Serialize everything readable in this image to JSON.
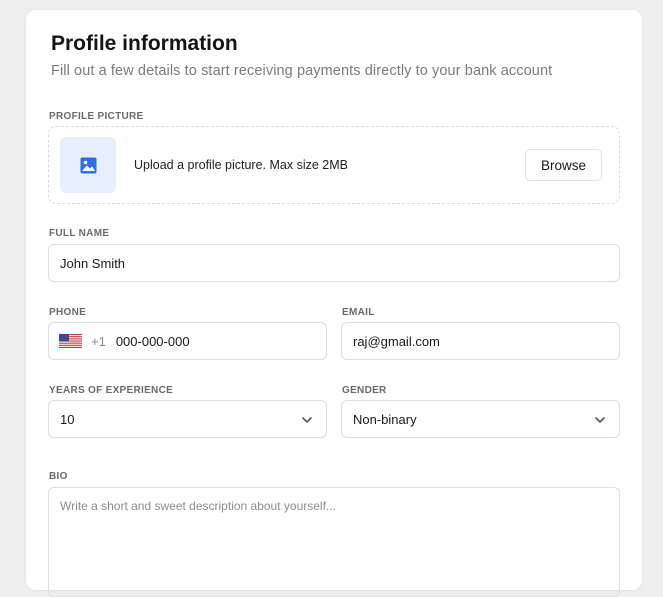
{
  "header": {
    "title": "Profile information",
    "subtitle": "Fill out a few details to start receiving payments directly to your bank account"
  },
  "profile_picture": {
    "label": "PROFILE PICTURE",
    "hint": "Upload a profile picture. Max size 2MB",
    "browse_label": "Browse",
    "icon": "image-icon"
  },
  "full_name": {
    "label": "FULL NAME",
    "value": "John Smith"
  },
  "phone": {
    "label": "PHONE",
    "flag_icon": "us-flag-icon",
    "country_code": "+1",
    "value": "000-000-000"
  },
  "email": {
    "label": "EMAIL",
    "value": "raj@gmail.com"
  },
  "experience": {
    "label": "YEARS OF EXPERIENCE",
    "selected": "10"
  },
  "gender": {
    "label": "GENDER",
    "selected": "Non-binary"
  },
  "bio": {
    "label": "BIO",
    "placeholder": "Write a short and sweet description about yourself..."
  },
  "colors": {
    "accent": "#2f6fe4",
    "thumb_bg": "#e8effc",
    "page_bg": "#efefef"
  }
}
